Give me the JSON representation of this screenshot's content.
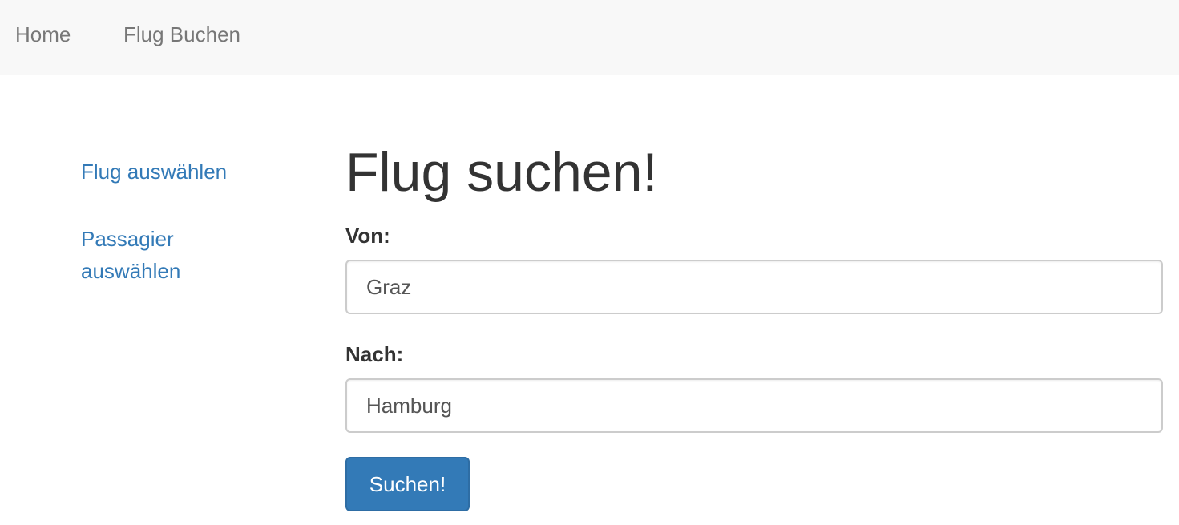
{
  "navbar": {
    "items": [
      {
        "label": "Home"
      },
      {
        "label": "Flug Buchen"
      }
    ]
  },
  "sidebar": {
    "items": [
      {
        "label": "Flug auswählen"
      },
      {
        "label": "Passagier auswählen"
      }
    ]
  },
  "main": {
    "title": "Flug suchen!",
    "from": {
      "label": "Von:",
      "value": "Graz"
    },
    "to": {
      "label": "Nach:",
      "value": "Hamburg"
    },
    "submit_label": "Suchen!"
  },
  "colors": {
    "link": "#337ab7",
    "navbar_bg": "#f8f8f8",
    "button_bg": "#337ab7",
    "text": "#333333"
  }
}
